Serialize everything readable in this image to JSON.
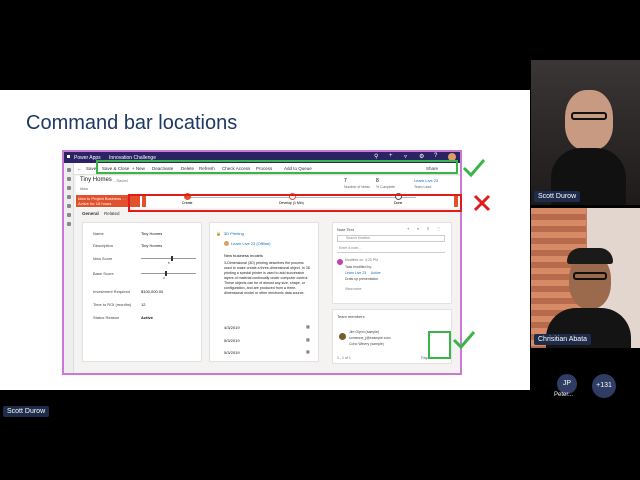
{
  "slide": {
    "title": "Command bar locations"
  },
  "app": {
    "app_name": "Power Apps",
    "env_name": "Innovation Challenge",
    "command_bar": [
      "Save",
      "Save & Close",
      "+ New",
      "Deactivate",
      "Delete",
      "Refresh",
      "Check Access",
      "Process",
      "Add to Queue"
    ],
    "share_label": "Share",
    "record_title": "Tiny Homes",
    "saved_state": "- Saved",
    "record_type": "Idea",
    "stat1_value": "7",
    "stat1_label": "Number of Ideas",
    "stat2_value": "8",
    "stat2_label": "% Complete",
    "owner_name": "Learn Live 23",
    "owner_role": "Team Lead",
    "bpf_active_title": "Idea to Project Business ...",
    "bpf_active_sub": "Active for 18 hours",
    "stages": [
      "Create",
      "Develop (1 Min)",
      "Done"
    ],
    "tabs": [
      "General",
      "Related"
    ],
    "fields": [
      {
        "label": "Name",
        "value": "Tiny Homes"
      },
      {
        "label": "Description",
        "value": "Tiny Homes"
      },
      {
        "label": "Idea Score",
        "value": "5"
      },
      {
        "label": "Base Score",
        "value": "4"
      },
      {
        "label": "Investment Required",
        "value": "$100,000.00"
      },
      {
        "label": "Time to ROI (months)",
        "value": "12"
      },
      {
        "label": "Status Reason",
        "value": "Active"
      }
    ],
    "mid_panel": {
      "heading": "3D Printing",
      "link": "Learn Live 23 (Offline)",
      "text1": "New business models",
      "body": "3-Dimensional (3D) printing describes the process used to make create a three-dimensional object. In 3D printing a special printer is used to add successive layers of material continually under computer control. These objects can be of almost any size, shape, or configuration, and are produced from a three-dimensional model or other electronic data source.",
      "dates": [
        "4/3/2019",
        "5/3/2019",
        "5/3/2019"
      ]
    },
    "right_panel": {
      "note_title": "Note Text",
      "search_placeholder": "Search timeline",
      "enter_note": "Enter a note...",
      "post_time": "Modified on: 4:20 PM",
      "post_line1": "Task modified by:",
      "post_line2": "Learn Live 23",
      "post_badge": "Active",
      "post_line3": "Draw up presentation",
      "view_more": "View more",
      "team_title": "Team members",
      "member_name": "Jim Glynn (sample)",
      "member_email": "someone_j@example.com",
      "member_org": "Coho Winery (sample)",
      "pager_range": "1 - 1 of 1",
      "pager_page": "Page 1"
    }
  },
  "participants": {
    "presenter_bottom": "Scott Durow",
    "cam1_name": "Scott Durow",
    "cam2_name": "Chrisitian Abata",
    "avatar_initials": "JP",
    "avatar_label": "Peter...",
    "more_count": "+131"
  },
  "colors": {
    "green": "#3bb54a",
    "red": "#e01b1b",
    "title_blue": "#1f3864",
    "topbar": "#2b2363",
    "bpf_active": "#e2512b"
  }
}
